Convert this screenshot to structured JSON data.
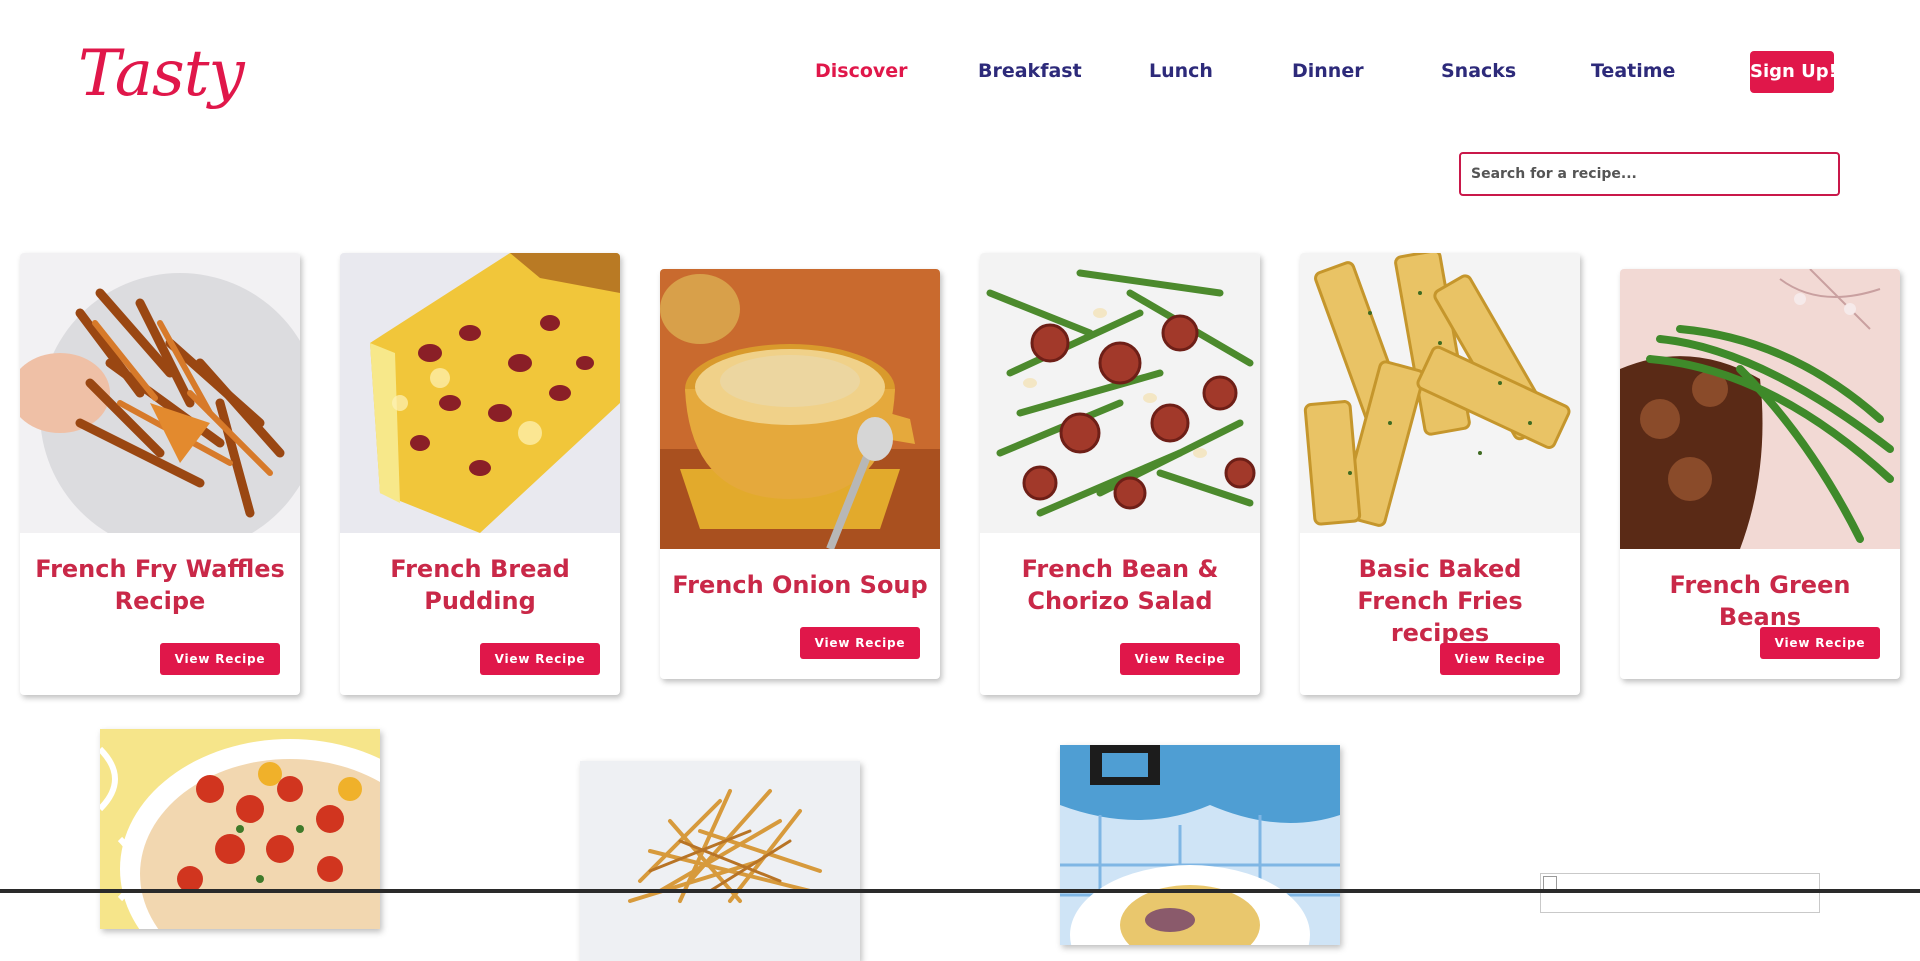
{
  "brand": {
    "logo_text": "Tasty",
    "accent_color": "#e0174a",
    "nav_color": "#2d2a7a"
  },
  "nav": {
    "items": [
      {
        "label": "Discover",
        "active": true
      },
      {
        "label": "Breakfast",
        "active": false
      },
      {
        "label": "Lunch",
        "active": false
      },
      {
        "label": "Dinner",
        "active": false
      },
      {
        "label": "Snacks",
        "active": false
      },
      {
        "label": "Teatime",
        "active": false
      }
    ],
    "signup_label": "Sign Up!"
  },
  "search": {
    "placeholder": "Search for a recipe...",
    "value": ""
  },
  "recipes": [
    {
      "title": "French Fry Waffles Recipe",
      "button": "View Recipe",
      "image": "fry-waffles-photo"
    },
    {
      "title": "French Bread Pudding",
      "button": "View Recipe",
      "image": "bread-pudding-photo"
    },
    {
      "title": "French Onion Soup",
      "button": "View Recipe",
      "image": "onion-soup-photo"
    },
    {
      "title": "French Bean & Chorizo Salad",
      "button": "View Recipe",
      "image": "bean-chorizo-photo"
    },
    {
      "title": "Basic Baked French Fries recipes",
      "button": "View Recipe",
      "image": "baked-fries-photo"
    },
    {
      "title": "French Green Beans",
      "button": "View Recipe",
      "image": "green-beans-photo"
    }
  ],
  "recipes_partial": [
    {
      "image": "tomato-bake-photo"
    },
    {
      "image": "shoestring-fries-photo"
    },
    {
      "image": "blue-napkin-dish-photo"
    },
    {
      "image": "broken-image-icon"
    }
  ]
}
